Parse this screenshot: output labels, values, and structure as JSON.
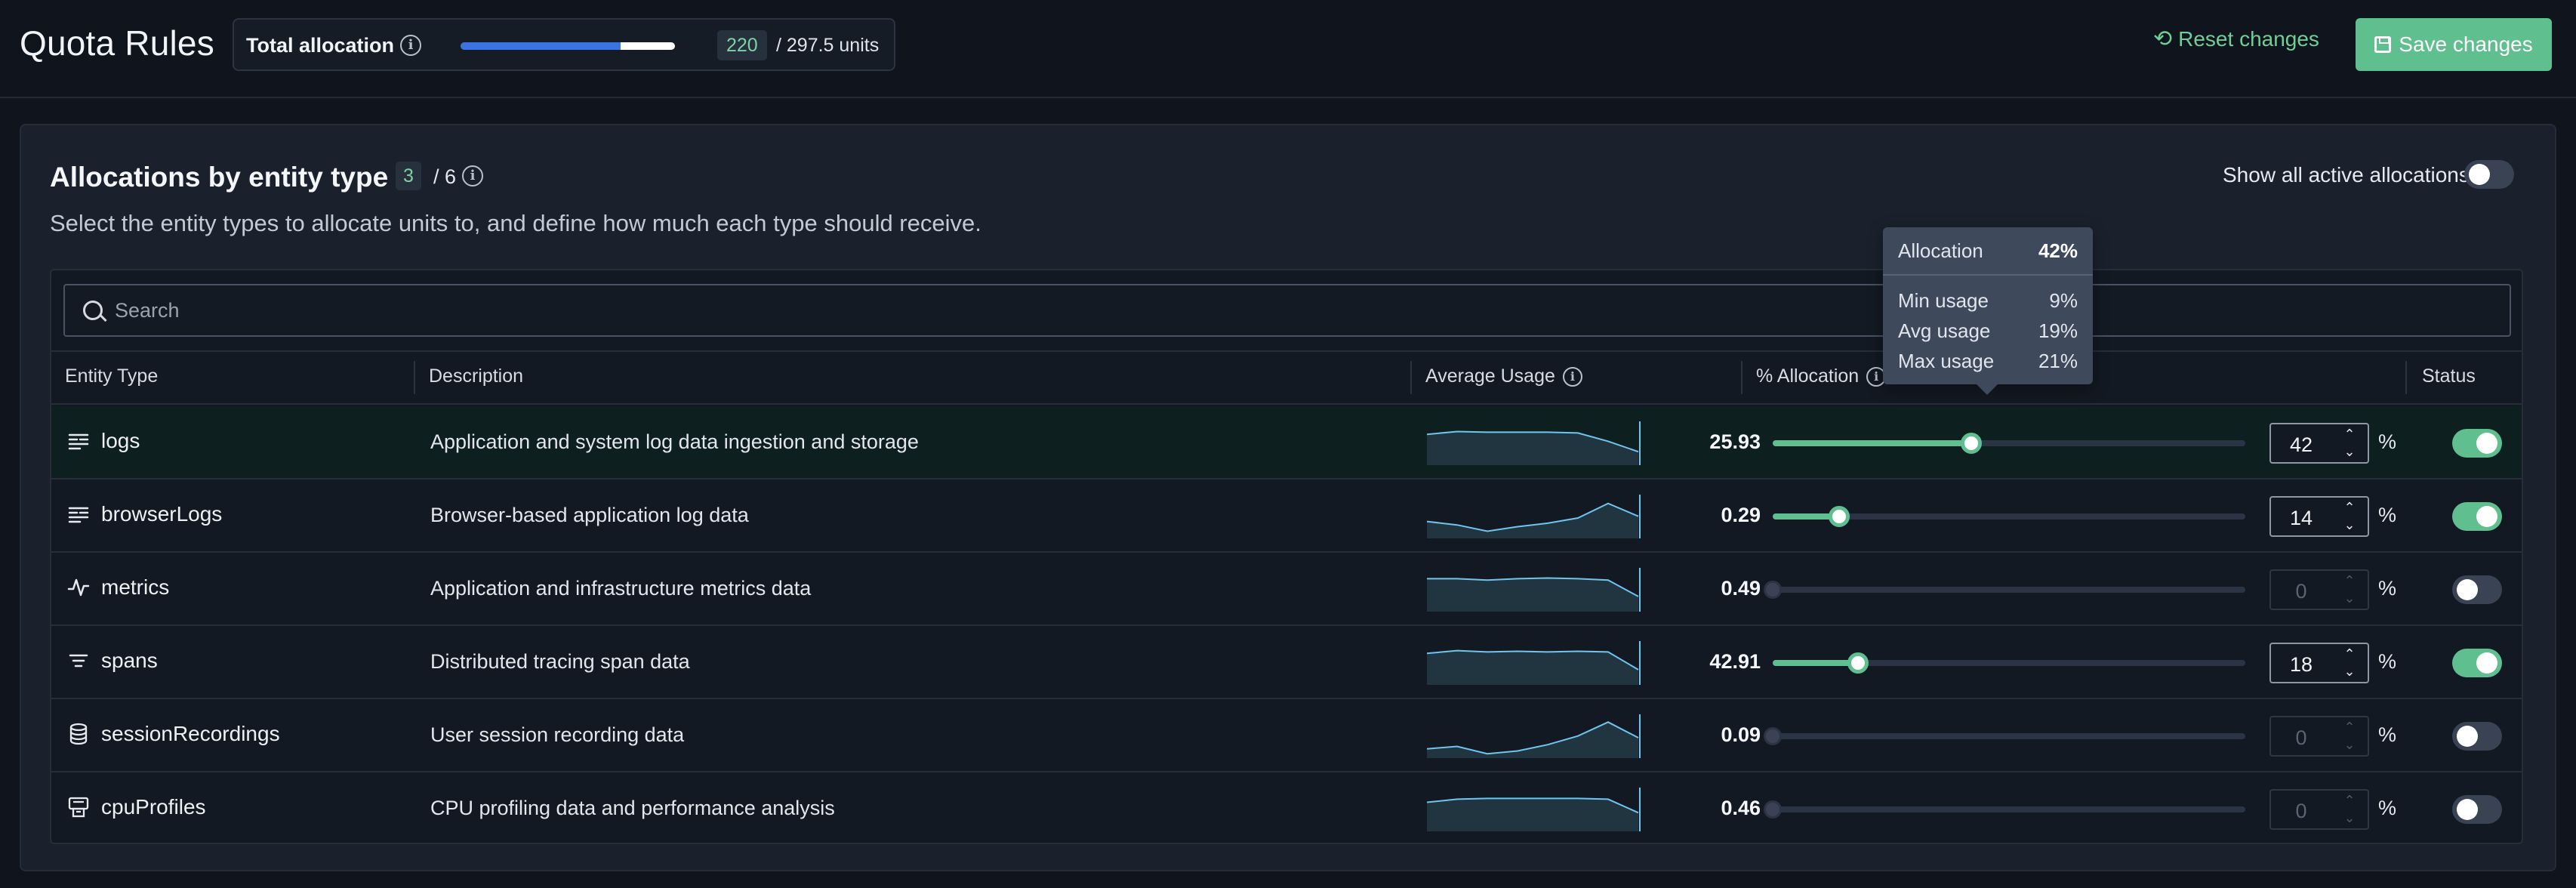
{
  "header": {
    "title": "Quota Rules",
    "total_allocation_label": "Total allocation",
    "allocated_units": "220",
    "total_units": "/ 297.5 units",
    "allocation_bar": {
      "blue_fraction": 0.745,
      "white_end_fraction": 1.0
    },
    "reset_label": "Reset changes",
    "save_label": "Save changes"
  },
  "section": {
    "title": "Allocations by entity type",
    "selected_count": "3",
    "total_count": "/ 6",
    "subtitle": "Select the entity types to allocate units to, and define how much each type should receive.",
    "show_all_label": "Show all active allocations",
    "show_all_on": false
  },
  "search": {
    "placeholder": "Search",
    "value": ""
  },
  "columns": {
    "entity_type": "Entity Type",
    "description": "Description",
    "average_usage": "Average Usage",
    "allocation": "% Allocation",
    "status": "Status"
  },
  "rows": [
    {
      "name": "logs",
      "icon": "list-lines-icon",
      "description": "Application and system log data ingestion and storage",
      "usage": "25.93",
      "allocation": "42",
      "allocation_pct": 42,
      "enabled": true,
      "spark": [
        0.8,
        0.88,
        0.86,
        0.86,
        0.86,
        0.84,
        0.6,
        0.3
      ]
    },
    {
      "name": "browserLogs",
      "icon": "list-lines-icon",
      "description": "Browser-based application log data",
      "usage": "0.29",
      "allocation": "14",
      "allocation_pct": 14,
      "enabled": true,
      "spark": [
        0.4,
        0.3,
        0.12,
        0.25,
        0.35,
        0.5,
        0.92,
        0.55
      ]
    },
    {
      "name": "metrics",
      "icon": "activity-icon",
      "description": "Application and infrastructure metrics data",
      "usage": "0.49",
      "allocation": "0",
      "allocation_pct": 0,
      "enabled": false,
      "spark": [
        0.86,
        0.86,
        0.82,
        0.86,
        0.88,
        0.86,
        0.82,
        0.35
      ]
    },
    {
      "name": "spans",
      "icon": "align-center-icon",
      "description": "Distributed tracing span data",
      "usage": "42.91",
      "allocation": "18",
      "allocation_pct": 18,
      "enabled": true,
      "spark": [
        0.82,
        0.9,
        0.86,
        0.88,
        0.86,
        0.88,
        0.86,
        0.35
      ]
    },
    {
      "name": "sessionRecordings",
      "icon": "database-icon",
      "description": "User session recording data",
      "usage": "0.09",
      "allocation": "0",
      "allocation_pct": 0,
      "enabled": false,
      "spark": [
        0.18,
        0.25,
        0.04,
        0.12,
        0.3,
        0.55,
        0.95,
        0.5
      ]
    },
    {
      "name": "cpuProfiles",
      "icon": "cpu-printer-icon",
      "description": "CPU profiling data and performance analysis",
      "usage": "0.46",
      "allocation": "0",
      "allocation_pct": 0,
      "enabled": false,
      "spark": [
        0.75,
        0.84,
        0.86,
        0.86,
        0.86,
        0.86,
        0.84,
        0.45
      ]
    }
  ],
  "tooltip": {
    "allocation_label": "Allocation",
    "allocation_value": "42%",
    "min_label": "Min usage",
    "min_value": "9%",
    "avg_label": "Avg usage",
    "avg_value": "19%",
    "max_label": "Max usage",
    "max_value": "21%"
  },
  "percent_sign": "%",
  "colors": {
    "accent_green": "#5fbf8f",
    "accent_blue": "#3b73e0",
    "spark_line": "#6ec6f0",
    "background": "#0f141d"
  }
}
